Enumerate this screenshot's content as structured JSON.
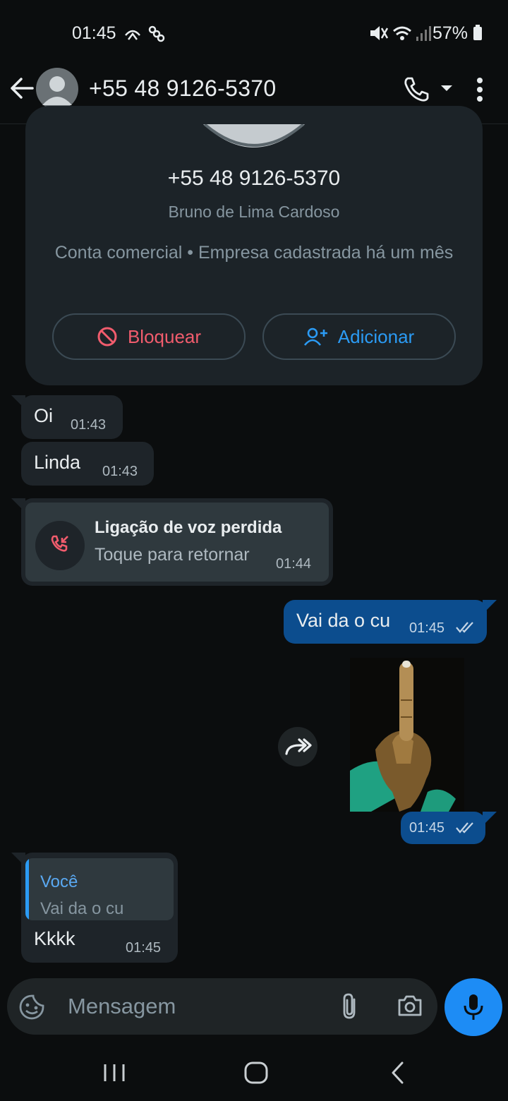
{
  "status_bar": {
    "time": "01:45",
    "battery": "57%"
  },
  "header": {
    "title": "+55 48 9126-5370"
  },
  "profile_card": {
    "phone": "+55 48 9126-5370",
    "name": "Bruno de Lima Cardoso",
    "description": "Conta comercial • Empresa cadastrada há um mês",
    "block_label": "Bloquear",
    "add_label": "Adicionar"
  },
  "messages": [
    {
      "text": "Oi",
      "time": "01:43"
    },
    {
      "text": "Linda",
      "time": "01:43"
    },
    {
      "title": "Ligação de voz perdida",
      "subtitle": "Toque para retornar",
      "time": "01:44"
    },
    {
      "text": "Vai da o cu",
      "time": "01:45"
    },
    {
      "time": "01:45"
    },
    {
      "quote_author": "Você",
      "quote_text": "Vai da o cu",
      "text": "Kkkk",
      "time": "01:45"
    }
  ],
  "input": {
    "placeholder": "Mensagem"
  },
  "colors": {
    "background": "#0b0d0e",
    "incoming_bubble": "#1e2429",
    "outgoing_bubble": "#0c4d8e",
    "accent_blue": "#1d8cf5",
    "danger_red": "#f15c6d"
  },
  "icons": {
    "back": "arrow-left-icon",
    "call": "phone-icon",
    "menu": "more-vert-icon",
    "attach": "paperclip-icon",
    "camera": "camera-icon",
    "mic": "mic-icon",
    "sticker": "sticker-icon",
    "forward": "forward-icon"
  }
}
